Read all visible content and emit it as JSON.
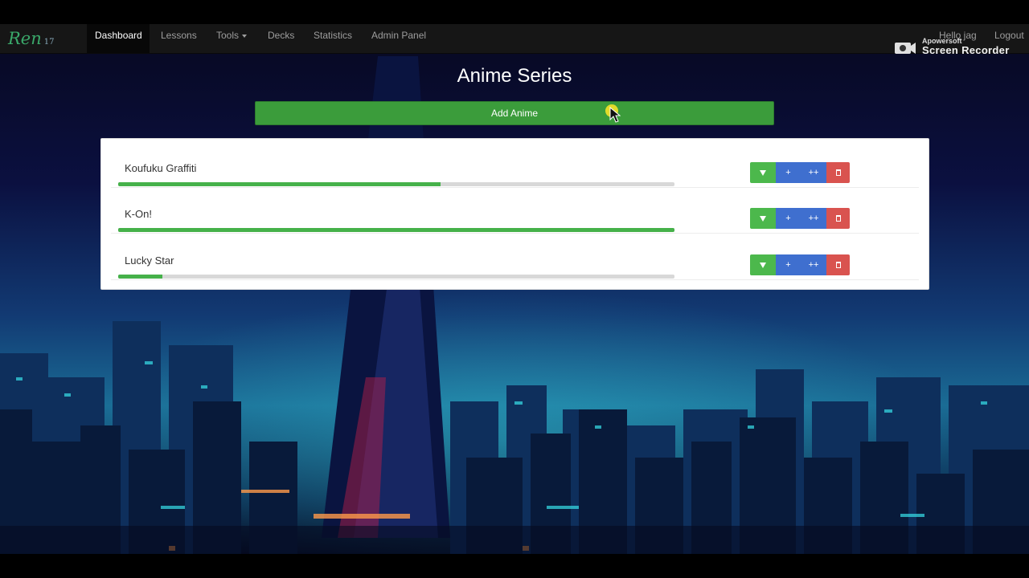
{
  "navbar": {
    "brand": "Ren",
    "brand_sub": "17",
    "items": [
      {
        "label": "Dashboard",
        "active": true
      },
      {
        "label": "Lessons"
      },
      {
        "label": "Tools",
        "dropdown": true
      },
      {
        "label": "Decks"
      },
      {
        "label": "Statistics"
      },
      {
        "label": "Admin Panel"
      }
    ],
    "user_greeting": "Hello jag",
    "logout": "Logout"
  },
  "watermark": {
    "line1": "Apowersoft",
    "line2": "Screen Recorder"
  },
  "main": {
    "title": "Anime Series",
    "add_button": "Add Anime",
    "series": [
      {
        "name": "Koufuku Graffiti",
        "progress": 0.58
      },
      {
        "name": "K-On!",
        "progress": 1.0
      },
      {
        "name": "Lucky Star",
        "progress": 0.08
      }
    ],
    "row_buttons": {
      "expand": "▼",
      "plus": "+",
      "plusplus": "++",
      "delete": "trash-icon"
    }
  },
  "colors": {
    "navbar_bg": "#161616",
    "success": "#3b9c3b",
    "progress_fill": "#46b14a",
    "primary": "#3f6fcf",
    "danger": "#d9534f"
  }
}
